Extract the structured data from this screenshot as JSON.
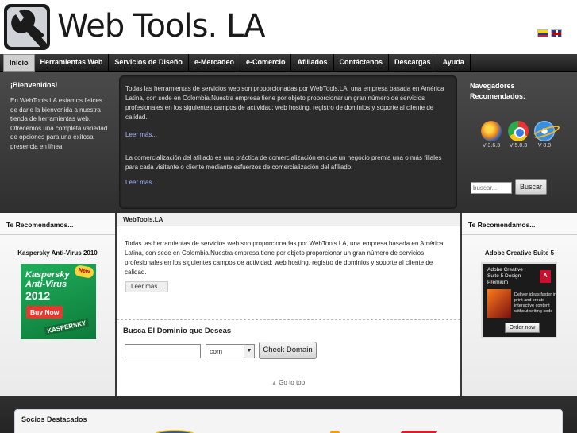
{
  "header": {
    "logo_text": "Web Tools. LA"
  },
  "nav": {
    "items": [
      "Inicio",
      "Herramientas Web",
      "Servicios de Diseño",
      "e-Mercadeo",
      "e-Comercio",
      "Afiliados",
      "Contáctenos",
      "Descargas",
      "Ayuda"
    ]
  },
  "welcome": {
    "title": "¡Bienvenidos!",
    "text": "En WebTools.LA estamos felices de darle la bienvenida a nuestra tienda de herramientas web. Ofrecemos una completa variedad de opciones para una exitosa presencia en línea."
  },
  "intro": {
    "p1": "Todas las herramientas de servicios web son proporcionadas por WebTools.LA, una empresa basada en América Latina, con sede en Colombia.Nuestra empresa tiene por objeto proporcionar un gran número de servicios profesionales en los siguientes campos de actividad: web hosting, registro de dominios y soporte al cliente de calidad.",
    "link1": "Leer más...",
    "p2": "La comercialización del afiliado es una práctica de comercialización en que un negocio premia una o más filiales para cada visitante o cliente mediante esfuerzos de comercialización del afiliado.",
    "link2": "Leer más..."
  },
  "browsers": {
    "title": "Navegadores Recomendados:",
    "items": [
      {
        "icon": "firefox-icon",
        "version": "V 3.6.3"
      },
      {
        "icon": "chrome-icon",
        "version": "V 5.0.3"
      },
      {
        "icon": "ie-icon",
        "version": "V 8.0"
      }
    ]
  },
  "search": {
    "placeholder": "buscar...",
    "button": "Buscar"
  },
  "left_ad": {
    "title": "Te Recomendamos...",
    "product": "Kaspersky Anti-Virus 2010",
    "box_badge": "New",
    "box_title": "Kaspersky Anti-Virus",
    "box_year": "2012",
    "box_button": "Buy Now",
    "box_brand": "KASPERSKY"
  },
  "right_ad": {
    "title": "Te Recomendamos...",
    "product": "Adobe Creative Suite 5",
    "box_title": "Adobe Creative Suite 5 Design Premium",
    "box_text": "Deliver ideas faster in print and create interactive content without writing code",
    "box_button": "Order now"
  },
  "main": {
    "header": "WebTools.LA",
    "text": "Todas las herramientas de servicios web son proporcionadas por WebTools.LA, una empresa basada en América Latina, con sede en Colombia.Nuestra empresa tiene por objeto proporcionar un gran número de servicios profesionales en los siguientes campos de actividad: web hosting, registro de dominios y soporte al cliente de calidad.",
    "more": "Leer más...",
    "domain_title": "Busca El Dominio que Deseas",
    "domain_value": "",
    "tld": "com",
    "check_button": "Check Domain",
    "go_top": "Go to top"
  },
  "partners": {
    "title": "Socios Destacados"
  }
}
